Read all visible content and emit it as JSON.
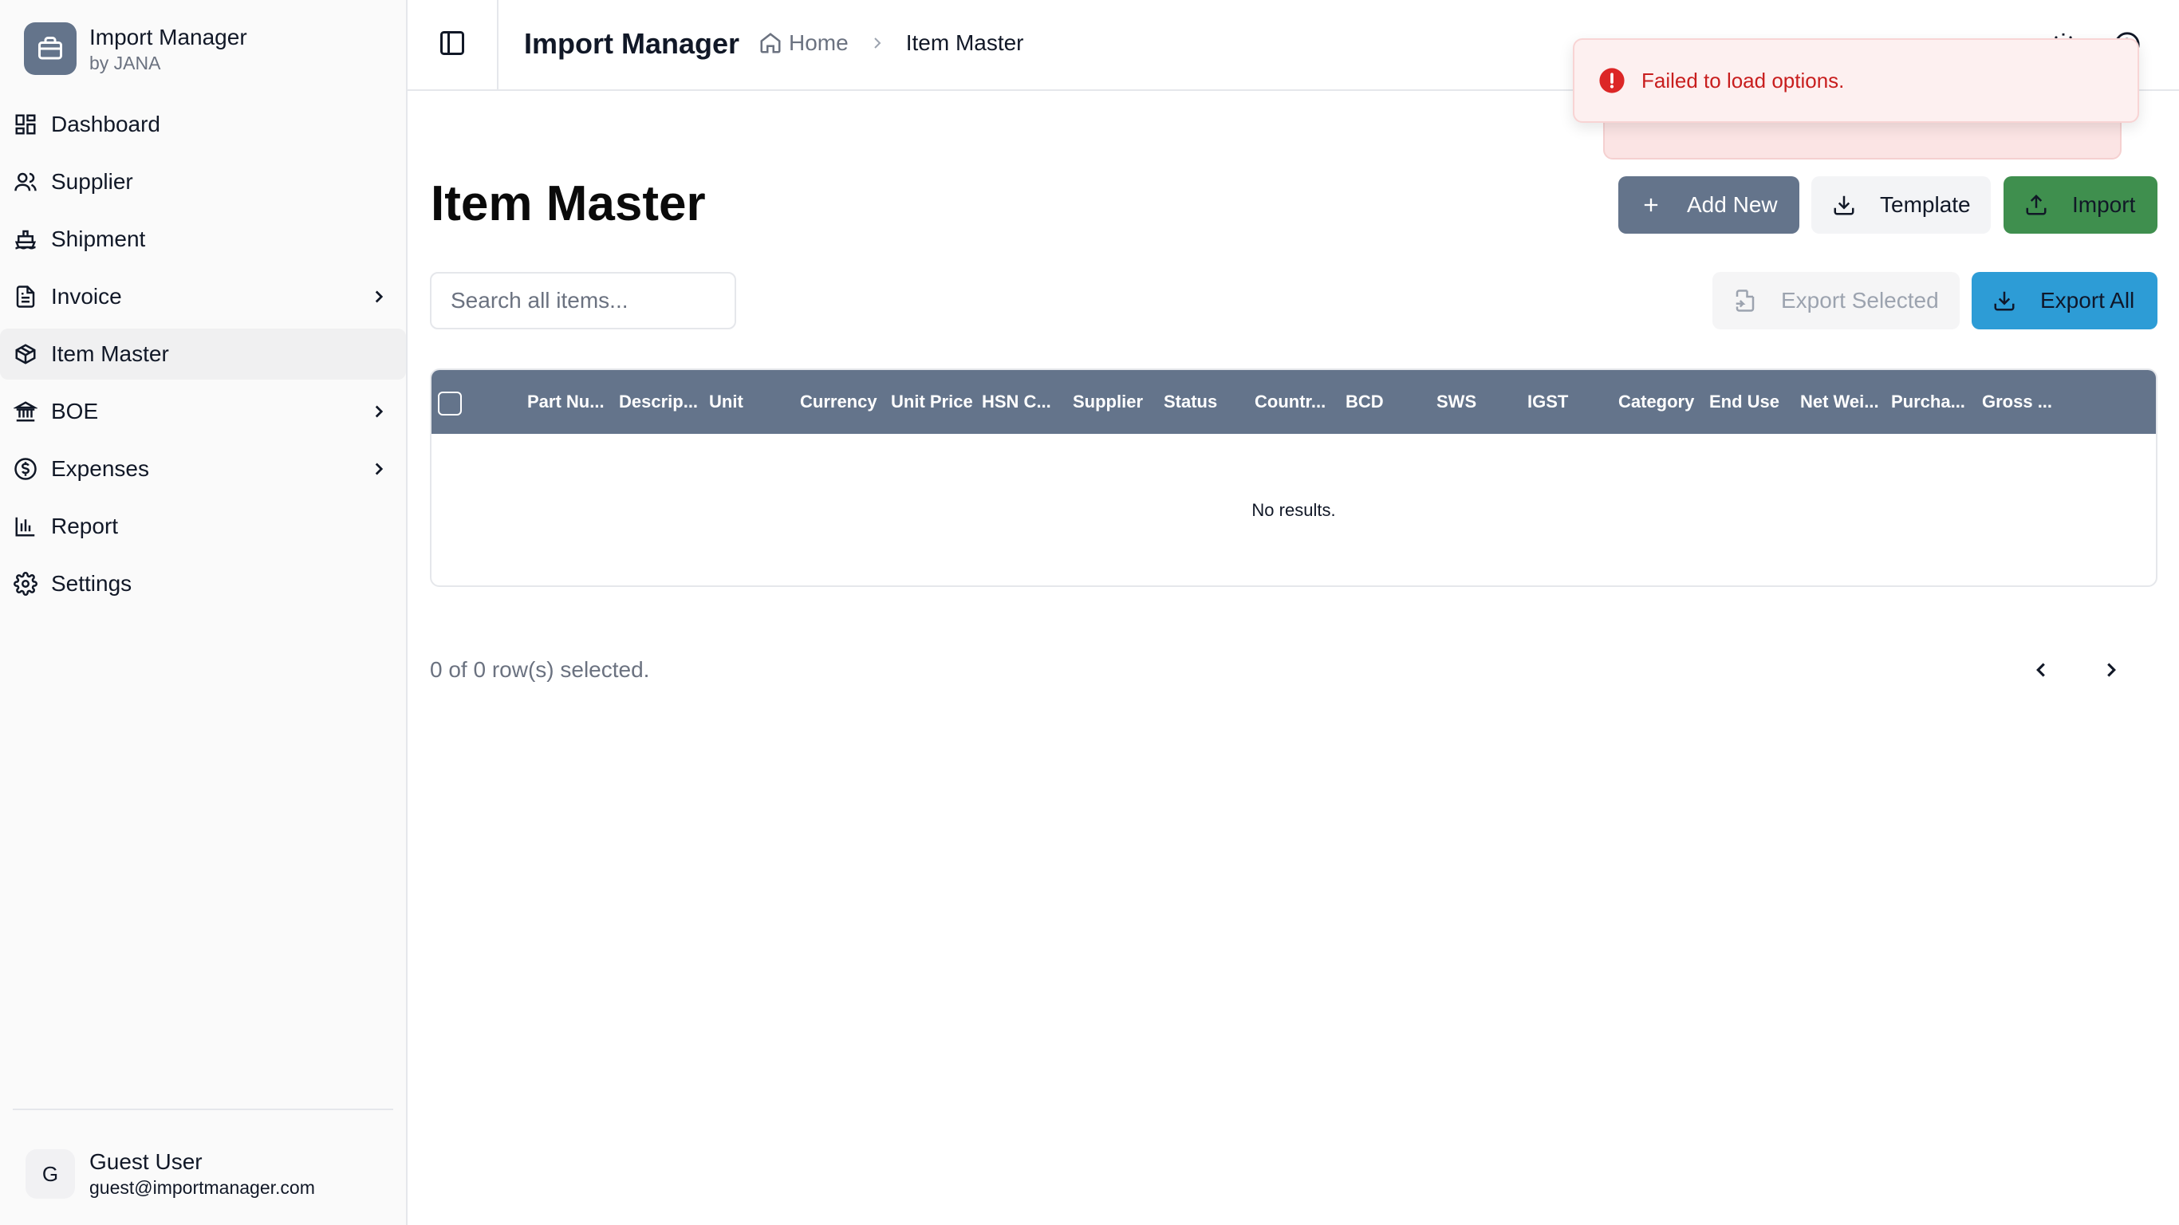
{
  "app": {
    "title": "Import Manager",
    "subtitle": "by JANA"
  },
  "sidebar": {
    "items": [
      {
        "label": "Dashboard",
        "icon": "dashboard-icon"
      },
      {
        "label": "Supplier",
        "icon": "users-icon"
      },
      {
        "label": "Shipment",
        "icon": "ship-icon"
      },
      {
        "label": "Invoice",
        "icon": "file-text-icon",
        "expandable": true
      },
      {
        "label": "Item Master",
        "icon": "package-icon",
        "active": true
      },
      {
        "label": "BOE",
        "icon": "landmark-icon",
        "expandable": true
      },
      {
        "label": "Expenses",
        "icon": "dollar-circle-icon",
        "expandable": true
      },
      {
        "label": "Report",
        "icon": "bar-chart-icon"
      },
      {
        "label": "Settings",
        "icon": "gear-icon"
      }
    ]
  },
  "user": {
    "initial": "G",
    "name": "Guest User",
    "email": "guest@importmanager.com"
  },
  "header": {
    "title": "Import Manager",
    "breadcrumb": {
      "home": "Home",
      "current": "Item Master"
    }
  },
  "toast": {
    "message": "Failed to load options.",
    "type": "error"
  },
  "page": {
    "title": "Item Master"
  },
  "actions": {
    "add_new": "Add New",
    "template": "Template",
    "import": "Import",
    "export_selected": "Export Selected",
    "export_all": "Export All"
  },
  "search": {
    "placeholder": "Search all items..."
  },
  "table": {
    "columns": [
      "Part Nu...",
      "Descrip...",
      "Unit",
      "Currency",
      "Unit Price",
      "HSN C...",
      "Supplier",
      "Status",
      "Countr...",
      "BCD",
      "SWS",
      "IGST",
      "Category",
      "End Use",
      "Net Wei...",
      "Purcha...",
      "Gross ..."
    ],
    "empty_text": "No results."
  },
  "footer": {
    "selection": "0 of 0 row(s) selected."
  },
  "colors": {
    "header_bg": "#64748b",
    "import_btn": "#3f8f4e",
    "export_all_btn": "#2d9cd6",
    "error": "#c81e1e"
  }
}
